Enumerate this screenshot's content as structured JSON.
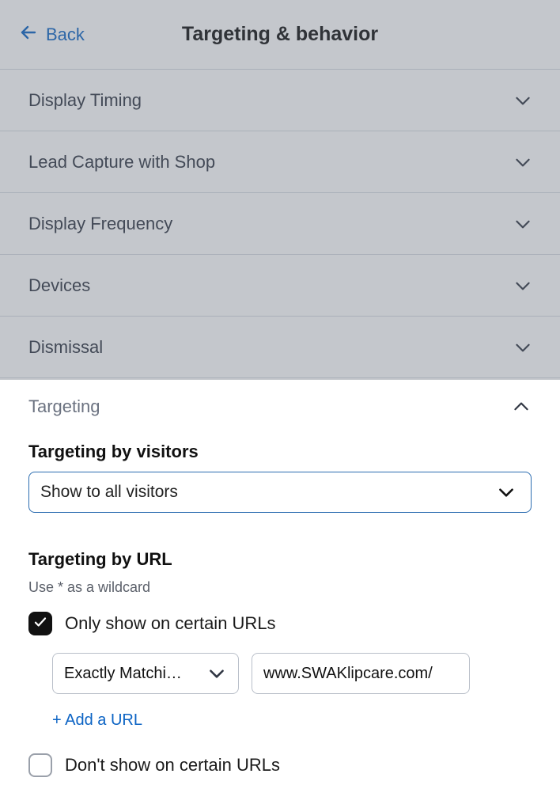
{
  "header": {
    "back_label": "Back",
    "title": "Targeting & behavior"
  },
  "collapsed_rows": [
    {
      "label": "Display Timing"
    },
    {
      "label": "Lead Capture with Shop"
    },
    {
      "label": "Display Frequency"
    },
    {
      "label": "Devices"
    },
    {
      "label": "Dismissal"
    }
  ],
  "targeting": {
    "panel_title": "Targeting",
    "by_visitors": {
      "label": "Targeting by visitors",
      "selected": "Show to all visitors"
    },
    "by_url": {
      "label": "Targeting by URL",
      "hint": "Use * as a wildcard",
      "only_show_label": "Only show on certain URLs",
      "match_type": "Exactly Matchi…",
      "url_value": "www.SWAKlipcare.com/",
      "add_url_label": "+ Add a URL",
      "dont_show_label": "Don't show on certain URLs"
    }
  }
}
